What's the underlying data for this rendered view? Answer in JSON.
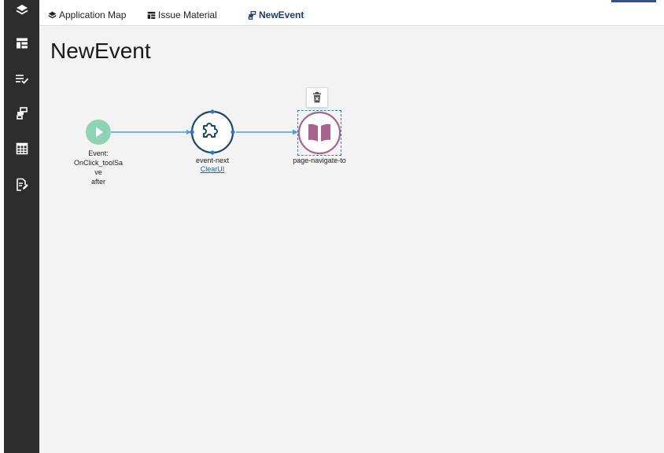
{
  "topbar": {
    "tabs": [
      {
        "label": "Application Map",
        "icon": "layers-icon"
      },
      {
        "label": "Issue Material",
        "icon": "table-layout-icon"
      },
      {
        "label": "NewEvent",
        "icon": "flow-icon",
        "active": true
      }
    ]
  },
  "sidebar": {
    "items": [
      {
        "icon": "layers-icon"
      },
      {
        "icon": "table-layout-icon"
      },
      {
        "icon": "checklist-icon"
      },
      {
        "icon": "flow-icon"
      },
      {
        "icon": "grid-icon"
      },
      {
        "icon": "edit-document-icon"
      }
    ]
  },
  "canvas": {
    "title": "NewEvent",
    "nodes": {
      "start": {
        "label_line1": "Event:",
        "label_line2": "OnClick_toolSa",
        "label_line3": "ve",
        "label_line4": "after",
        "color": "#8fd3b6"
      },
      "event_next": {
        "label": "event-next",
        "link": "ClearUI",
        "color": "#1d4a63"
      },
      "page_navigate": {
        "label": "page-navigate-to",
        "color": "#a8648f"
      }
    }
  },
  "colors": {
    "sidebar_bg": "#2d2d2d",
    "connector": "#4a9fe3",
    "accent": "#3a4d8f"
  }
}
